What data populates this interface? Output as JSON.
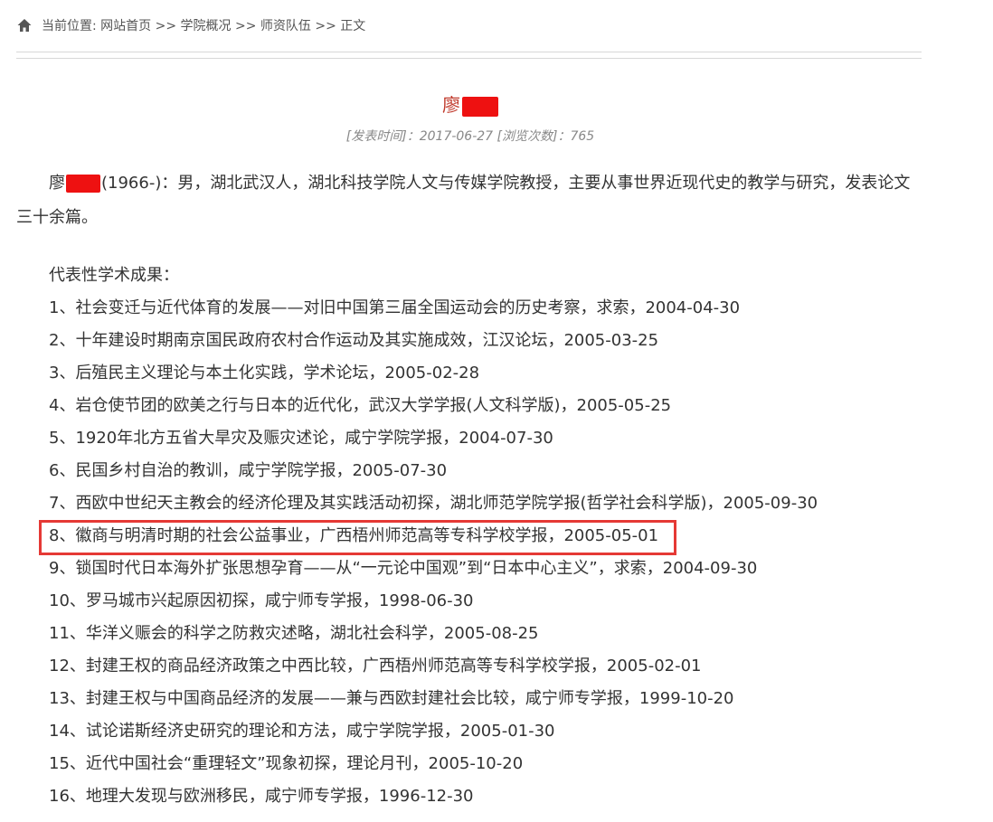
{
  "breadcrumb": {
    "icon": "home-icon",
    "text": "当前位置: 网站首页 >> 学院概况 >> 师资队伍 >> 正文"
  },
  "article": {
    "title_visible": "廖",
    "meta": "[发表时间]：2017-06-27 [浏览次数]：765",
    "intro_prefix": "廖",
    "intro_rest": "(1966-)：男，湖北武汉人，湖北科技学院人文与传媒学院教授，主要从事世界近现代史的教学与研究，发表论文三十余篇。",
    "section_title": "代表性学术成果：",
    "items": [
      "1、社会变迁与近代体育的发展——对旧中国第三届全国运动会的历史考察，求索，2004-04-30",
      "2、十年建设时期南京国民政府农村合作运动及其实施成效，江汉论坛，2005-03-25",
      "3、后殖民主义理论与本土化实践，学术论坛，2005-02-28",
      "4、岩仓使节团的欧美之行与日本的近代化，武汉大学学报(人文科学版)，2005-05-25",
      "5、1920年北方五省大旱灾及赈灾述论，咸宁学院学报，2004-07-30",
      "6、民国乡村自治的教训，咸宁学院学报，2005-07-30",
      "7、西欧中世纪天主教会的经济伦理及其实践活动初探，湖北师范学院学报(哲学社会科学版)，2005-09-30",
      "8、徽商与明清时期的社会公益事业，广西梧州师范高等专科学校学报，2005-05-01",
      "9、锁国时代日本海外扩张思想孕育——从“一元论中国观”到“日本中心主义”，求索，2004-09-30",
      "10、罗马城市兴起原因初探，咸宁师专学报，1998-06-30",
      "11、华洋义赈会的科学之防救灾述略，湖北社会科学，2005-08-25",
      "12、封建王权的商品经济政策之中西比较，广西梧州师范高等专科学校学报，2005-02-01",
      "13、封建王权与中国商品经济的发展——兼与西欧封建社会比较，咸宁师专学报，1999-10-20",
      "14、试论诺斯经济史研究的理论和方法，咸宁学院学报，2005-01-30",
      "15、近代中国社会“重理轻文”现象初探，理论月刊，2005-10-20",
      "16、地理大发现与欧洲移民，咸宁师专学报，1996-12-30"
    ]
  },
  "colors": {
    "title": "#c0392b",
    "redaction": "#ee1111",
    "highlight_border": "#e53935",
    "meta": "#888888"
  }
}
